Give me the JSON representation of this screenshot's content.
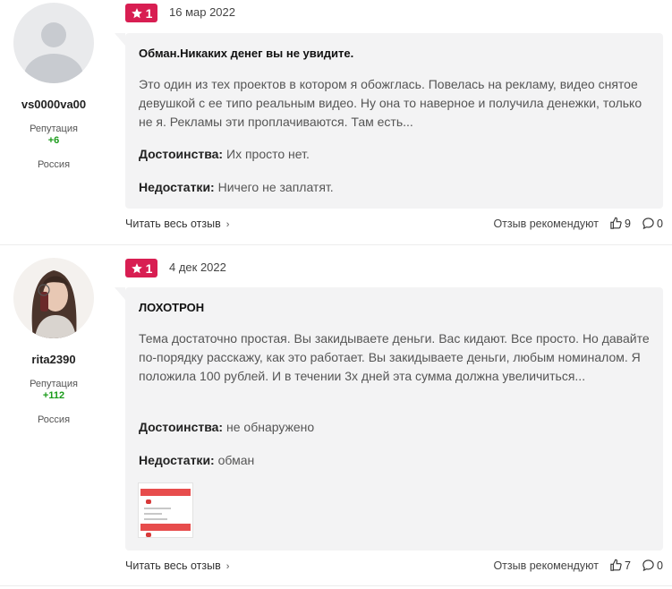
{
  "labels": {
    "reputation": "Репутация",
    "pros": "Достоинства:",
    "cons": "Недостатки:",
    "read_more": "Читать весь отзыв",
    "recommend": "Отзыв рекомендуют"
  },
  "reviews": [
    {
      "author": "vs0000va00",
      "reputation": "+6",
      "country": "Россия",
      "rating": "1",
      "date": "16 мар 2022",
      "title": "Обман.Никаких денег вы не увидите.",
      "text": "Это один из тех проектов в котором я обожглась. Повелась на рекламу, видео снятое девушкой с ее типо реальным видео. Ну она то наверное и получила денежки, только не я. Рекламы эти проплачиваются. Там есть...",
      "pros": "Их просто нет.",
      "cons": "Ничего не заплатят.",
      "likes": "9",
      "comments": "0"
    },
    {
      "author": "rita2390",
      "reputation": "+112",
      "country": "Россия",
      "rating": "1",
      "date": "4 дек 2022",
      "title": "ЛОХОТРОН",
      "text": "Тема достаточно простая. Вы закидываете деньги. Вас кидают. Все просто. Но давайте по-порядку расскажу, как это работает. Вы закидываете деньги, любым номиналом. Я положила 100 рублей. И в течении 3х дней эта сумма должна увеличиться...",
      "pros": "не обнаружено",
      "cons": "обман",
      "likes": "7",
      "comments": "0"
    }
  ],
  "colors": {
    "rating_badge": "#d81e52",
    "reputation": "#1a9b1a",
    "bubble": "#f3f3f4"
  }
}
